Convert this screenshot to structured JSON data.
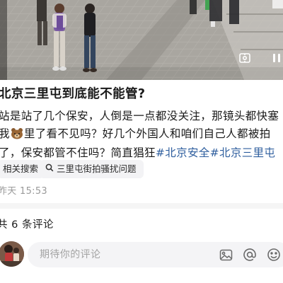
{
  "post": {
    "title": "北京三里屯到底能不能管?",
    "body_lines": [
      "站是站了几个保安，人倒是一点都没关注，那镜头都快塞",
      "里了看不见吗？好几个外国人和咱们自己人都被拍",
      "了，保安都管不住吗？简直猖狂"
    ],
    "body_line2_prefix": "我",
    "hashtags": [
      "#北京安全",
      "#北京三里屯"
    ],
    "bear_emoji": "🐻"
  },
  "related": {
    "label": "相关搜索",
    "query": "三里屯街拍骚扰问题"
  },
  "meta": {
    "timestamp": "昨天 15:53",
    "comment_count": "共 6 条评论"
  },
  "comment_bar": {
    "placeholder": "期待你的评论"
  },
  "icons": {
    "video": [
      "pip-icon",
      "pause-icon"
    ],
    "related": "search-icon",
    "comment_bar": [
      "image-icon",
      "at-icon",
      "emoji-icon"
    ]
  },
  "colors": {
    "hashtag": "#2e5e9e",
    "chip_bg": "#f3f3f5",
    "timestamp": "#9a9a9a"
  }
}
